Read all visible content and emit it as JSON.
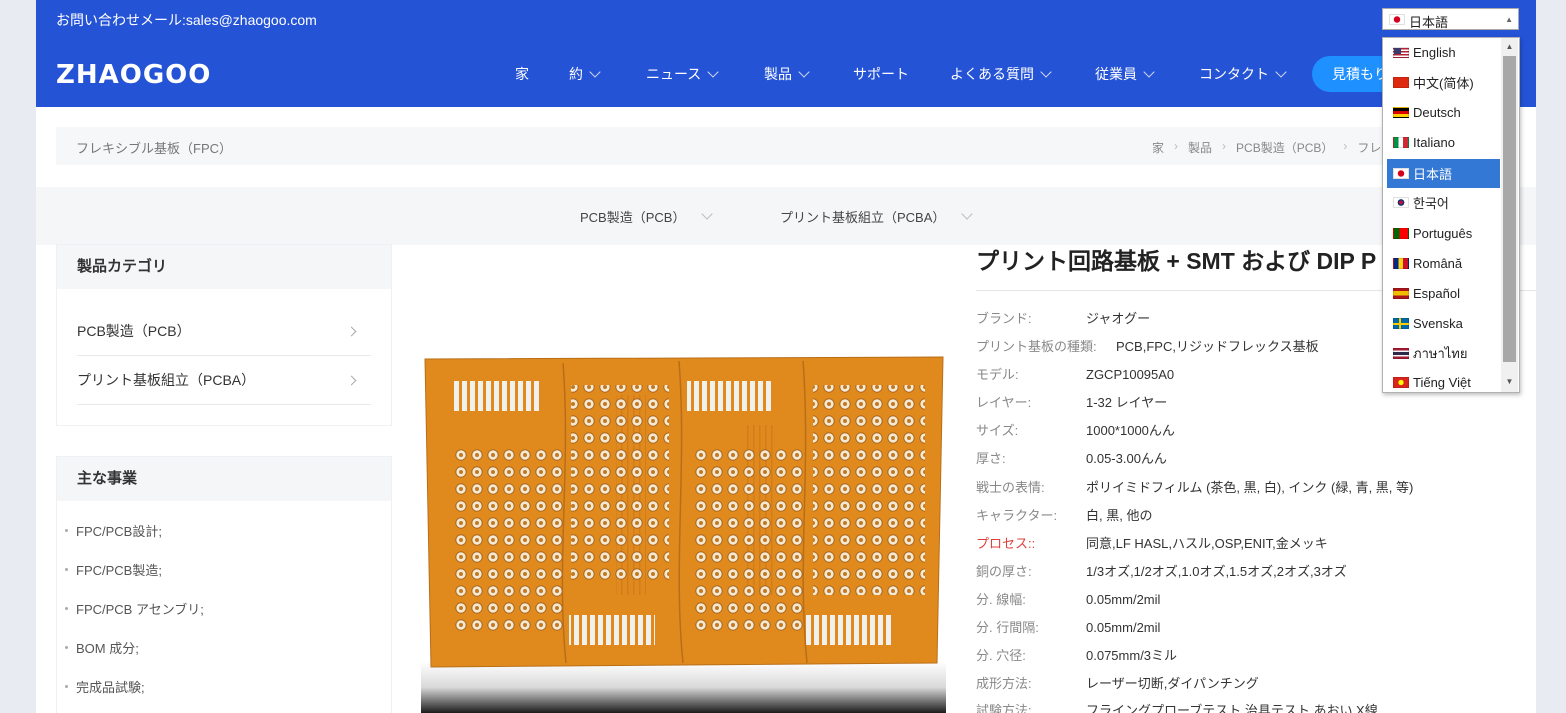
{
  "header": {
    "email": "お問い合わせメール:sales@zhaogoo.com",
    "logo": "ZHAOGOO",
    "nav": [
      "家",
      "約",
      "ニュース",
      "製品",
      "サポート",
      "よくある質問",
      "従業員",
      "コンタクト"
    ],
    "quote_button": "見積もり"
  },
  "language": {
    "selected": "日本語",
    "options": [
      "English",
      "中文(简体)",
      "Deutsch",
      "Italiano",
      "日本語",
      "한국어",
      "Português",
      "Română",
      "Español",
      "Svenska",
      "ภาษาไทย",
      "Tiếng Việt"
    ]
  },
  "breadcrumb": {
    "title": "フレキシブル基板（FPC）",
    "items": [
      "家",
      "製品",
      "PCB製造（PCB）",
      "フレキ"
    ]
  },
  "category_tabs": [
    "PCB製造（PCB）",
    "プリント基板組立（PCBA）"
  ],
  "sidebar": {
    "categories_title": "製品カテゴリ",
    "categories": [
      "PCB製造（PCB）",
      "プリント基板組立（PCBA）"
    ],
    "business_title": "主な事業",
    "business": [
      "FPC/PCB設計;",
      "FPC/PCB製造;",
      "FPC/PCB アセンブリ;",
      "BOM 成分;",
      "完成品試験;"
    ]
  },
  "product": {
    "title": "プリント回路基板 + SMT および DIP P",
    "specs": [
      {
        "label": "ブランド:",
        "value": "ジャオグー"
      },
      {
        "label": "プリント基板の種類:",
        "value": "PCB,FPC,リジッドフレックス基板"
      },
      {
        "label": "モデル:",
        "value": "ZGCP10095A0"
      },
      {
        "label": "レイヤー:",
        "value": "1-32 レイヤー"
      },
      {
        "label": "サイズ:",
        "value": "1000*1000んん"
      },
      {
        "label": "厚さ:",
        "value": "0.05-3.00んん"
      },
      {
        "label": "戦士の表情:",
        "value": "ポリイミドフィルム (茶色, 黒, 白), インク (緑, 青, 黒, 等)"
      },
      {
        "label": "キャラクター:",
        "value": "白, 黒, 他の"
      },
      {
        "label": "プロセス::",
        "value": "同意,LF HASL,ハスル,OSP,ENIT,金メッキ"
      },
      {
        "label": "銅の厚さ:",
        "value": "1/3オズ,1/2オズ,1.0オズ,1.5オズ,2オズ,3オズ"
      },
      {
        "label": "分. 線幅:",
        "value": "0.05mm/2mil"
      },
      {
        "label": "分. 行間隔:",
        "value": "0.05mm/2mil"
      },
      {
        "label": "分. 穴径:",
        "value": "0.075mm/3ミル"
      },
      {
        "label": "成形方法:",
        "value": "レーザー切断,ダイパンチング"
      },
      {
        "label": "試験方法:",
        "value": "フライングプローブテスト,治具テスト,あおい,X線"
      }
    ]
  },
  "colors": {
    "brand_blue": "#2453d6",
    "quote_blue": "#1e90ff",
    "highlight_red": "#e0413b",
    "pcb_orange": "#e08a1e"
  }
}
